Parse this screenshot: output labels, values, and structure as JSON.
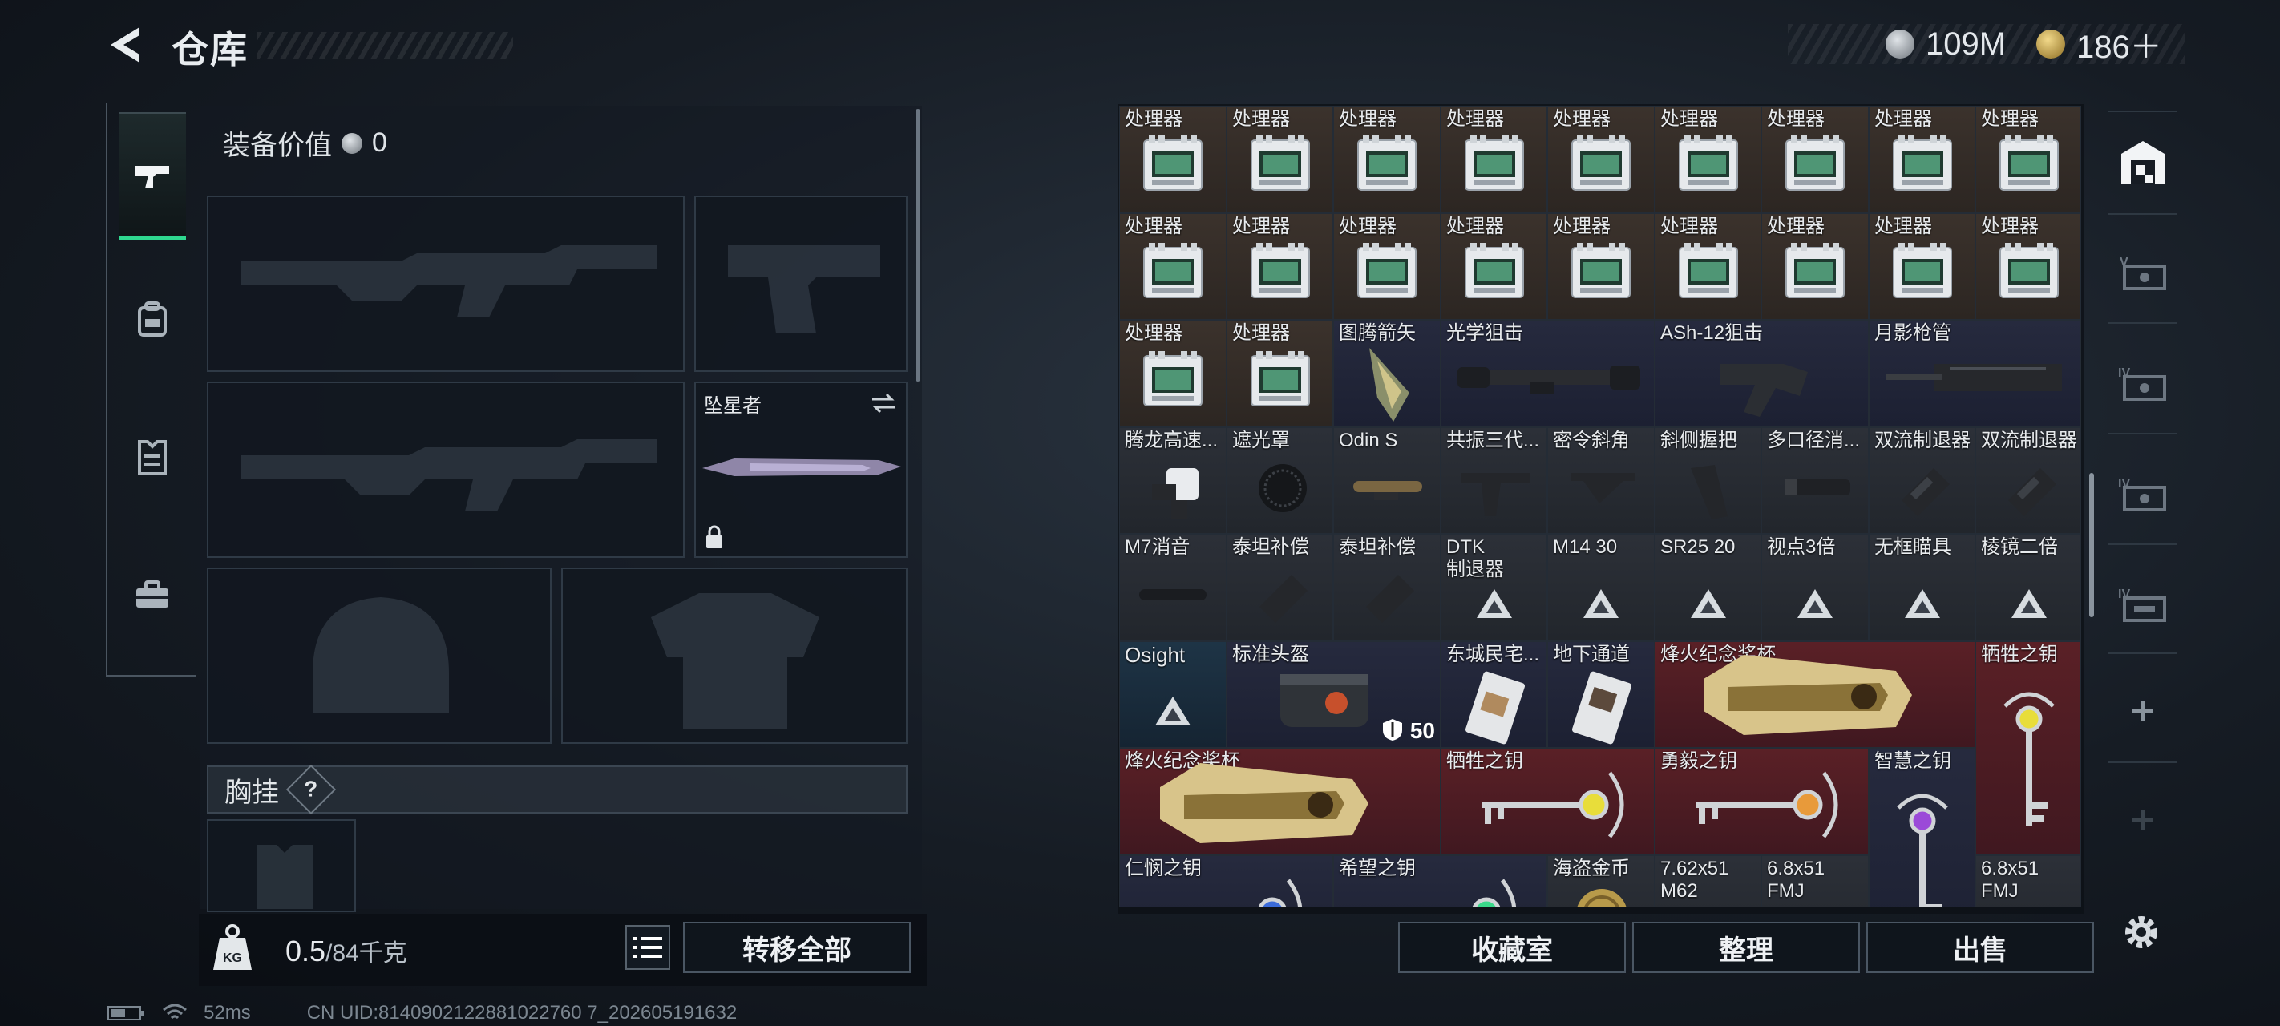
{
  "header": {
    "title": "仓库",
    "currency_1": "109M",
    "currency_2": "186＋"
  },
  "categories": [
    {
      "name": "weapons",
      "icon": "pistol-icon",
      "active": true
    },
    {
      "name": "gear",
      "icon": "backpack-icon",
      "active": false
    },
    {
      "name": "armor",
      "icon": "vest-icon",
      "active": false
    },
    {
      "name": "misc",
      "icon": "toolbox-icon",
      "active": false
    }
  ],
  "equipment": {
    "value_label": "装备价值",
    "value": "0",
    "secondary_weapon_name": "坠星者",
    "chest_rig_label": "胸挂",
    "chest_rig_help": "?"
  },
  "footer": {
    "weight_current": "0.5",
    "weight_max": "/84千克",
    "transfer_all": "转移全部",
    "collection_room": "收藏室",
    "organize": "整理",
    "sell": "出售"
  },
  "status": {
    "ping": "52ms",
    "uid": "CN UID:8140902122881022760 7_202605191632"
  },
  "colors": {
    "accent_green": "#2fd88f",
    "cell_brown": "#3b322c",
    "cell_navy": "#262a3e",
    "cell_red": "#5a2026",
    "cell_blue": "#1e3446"
  },
  "inventory": {
    "row1": [
      "处理器",
      "处理器",
      "处理器",
      "处理器",
      "处理器",
      "处理器",
      "处理器",
      "处理器",
      "处理器"
    ],
    "row2": [
      "处理器",
      "处理器",
      "处理器",
      "处理器",
      "处理器",
      "处理器",
      "处理器",
      "处理器",
      "处理器"
    ],
    "row3": [
      {
        "label": "处理器"
      },
      {
        "label": "处理器"
      },
      {
        "label": "图腾箭矢"
      },
      {
        "label": "光学狙击"
      },
      {
        "label": "ASh-12狙击"
      },
      {
        "label": "月影枪管"
      }
    ],
    "row4": [
      "腾龙高速...",
      "遮光罩",
      "Odin S",
      "共振三代...",
      "密令斜角",
      "斜侧握把",
      "多口径消...",
      "双流制退器",
      "双流制退器"
    ],
    "row5": [
      "M7消音",
      "泰坦补偿",
      "泰坦补偿",
      "DTK\n制退器",
      "M14 30",
      "SR25 20",
      "视点3倍",
      "无框瞄具",
      "棱镜二倍"
    ],
    "row6": [
      {
        "label": "Osight"
      },
      {
        "label": "标准头盔",
        "count": "50"
      },
      {
        "label": "东城民宅..."
      },
      {
        "label": "地下通道"
      },
      {
        "label": "烽火纪念奖杯"
      },
      {
        "label": "牺牲之钥"
      }
    ],
    "row7": [
      {
        "label": "烽火纪念奖杯"
      },
      {
        "label": "牺牲之钥"
      },
      {
        "label": "勇毅之钥"
      },
      {
        "label": "智慧之钥"
      }
    ],
    "row8": [
      {
        "label": "仁悯之钥"
      },
      {
        "label": "希望之钥"
      },
      {
        "label": "海盗金币"
      },
      {
        "label": "7.62x51\nM62"
      },
      {
        "label": "6.8x51\nFMJ"
      },
      {
        "label": "6.8x51\nFMJ"
      }
    ]
  }
}
